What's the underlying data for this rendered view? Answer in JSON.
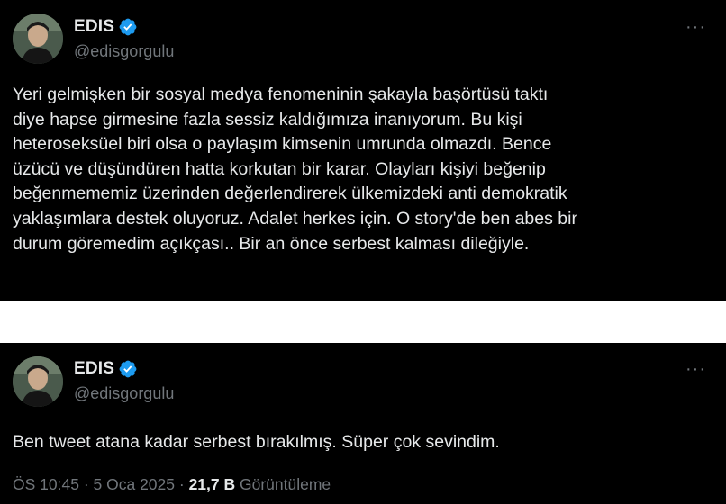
{
  "tweets": [
    {
      "display_name": "EDIS",
      "handle": "@edisgorgulu",
      "more_label": "···",
      "text_lines": [
        "Yeri gelmişken bir sosyal medya fenomeninin şakayla başörtüsü taktı",
        "diye hapse girmesine fazla sessiz kaldığımıza inanıyorum. Bu kişi",
        "heteroseksüel biri olsa o paylaşım kimsenin umrunda olmazdı. Bence",
        "üzücü ve düşündüren hatta korkutan bir karar. Olayları kişiyi beğenip",
        "beğenmememiz üzerinden değerlendirerek ülkemizdeki anti demokratik",
        "yaklaşımlara destek oluyoruz. Adalet herkes için. O story'de ben abes bir",
        "durum göremedim açıkçası.. Bir an önce serbest kalması dileğiyle."
      ]
    },
    {
      "display_name": "EDIS",
      "handle": "@edisgorgulu",
      "more_label": "···",
      "text_lines": [
        "Ben tweet atana kadar serbest bırakılmış. Süper çok sevindim."
      ],
      "meta": {
        "time": "ÖS 10:45",
        "sep1": " · ",
        "date": "5 Oca 2025",
        "sep2": " · ",
        "views_count": "21,7 B",
        "views_label": " Görüntüleme"
      }
    }
  ],
  "colors": {
    "background": "#000000",
    "text": "#e7e9ea",
    "secondary": "#71767b",
    "verified": "#1d9bf0"
  },
  "icons": {
    "verified": "verified-badge-icon",
    "more": "more-horizontal-icon"
  }
}
